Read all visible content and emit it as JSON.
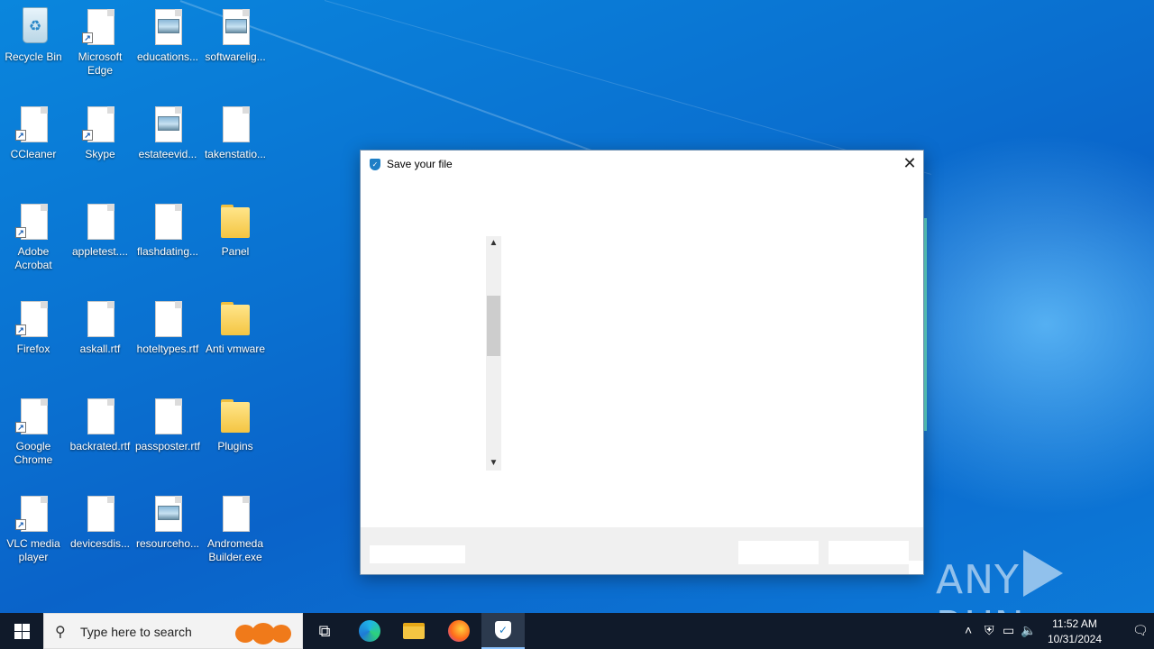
{
  "desktop": {
    "icons": [
      {
        "label": "Recycle Bin",
        "type": "bin"
      },
      {
        "label": "Microsoft Edge",
        "type": "doc-shortcut"
      },
      {
        "label": "educations...",
        "type": "image"
      },
      {
        "label": "softwarelig...",
        "type": "image"
      },
      {
        "label": "CCleaner",
        "type": "doc-shortcut"
      },
      {
        "label": "Skype",
        "type": "doc-shortcut"
      },
      {
        "label": "estateevid...",
        "type": "image"
      },
      {
        "label": "takenstatio...",
        "type": "doc"
      },
      {
        "label": "Adobe Acrobat",
        "type": "doc-shortcut"
      },
      {
        "label": "appletest....",
        "type": "doc"
      },
      {
        "label": "flashdating...",
        "type": "doc"
      },
      {
        "label": "Panel",
        "type": "folder"
      },
      {
        "label": "Firefox",
        "type": "doc-shortcut"
      },
      {
        "label": "askall.rtf",
        "type": "doc"
      },
      {
        "label": "hoteltypes.rtf",
        "type": "doc"
      },
      {
        "label": "Anti vmware",
        "type": "folder"
      },
      {
        "label": "Google Chrome",
        "type": "doc-shortcut"
      },
      {
        "label": "backrated.rtf",
        "type": "doc"
      },
      {
        "label": "passposter.rtf",
        "type": "doc"
      },
      {
        "label": "Plugins",
        "type": "folder"
      },
      {
        "label": "VLC media player",
        "type": "doc-shortcut"
      },
      {
        "label": "devicesdis...",
        "type": "doc"
      },
      {
        "label": "resourceho...",
        "type": "image"
      },
      {
        "label": "Andromeda Builder.exe",
        "type": "doc"
      }
    ]
  },
  "dialog": {
    "title": "Save your file",
    "close_glyph": "✕"
  },
  "watermark": {
    "left": "ANY",
    "right": "RUN"
  },
  "taskbar": {
    "search_placeholder": "Type here to search",
    "time": "11:52 AM",
    "date": "10/31/2024",
    "icons": [
      "task-view-icon",
      "edge-icon",
      "file-explorer-icon",
      "firefox-icon",
      "shield-app-icon"
    ]
  }
}
